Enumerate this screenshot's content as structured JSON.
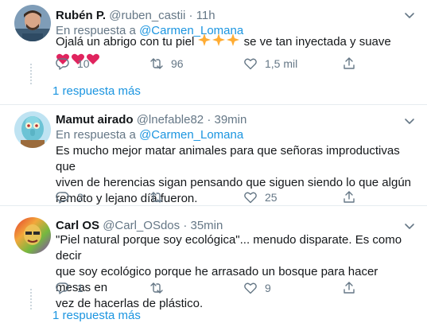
{
  "tweets": [
    {
      "name": "Rubén P.",
      "handle": "@ruben_castii",
      "dot": "·",
      "time": "11h",
      "reply_prefix": "En respuesta a",
      "reply_to": "@Carmen_Lomana",
      "text_before": "Ojalá un abrigo con tu piel",
      "text_after": "se ve tan inyectada y suave",
      "replies": "10",
      "retweets": "96",
      "likes": "1,5 mil",
      "more": "1 respuesta más"
    },
    {
      "name": "Mamut airado",
      "handle": "@lnefable82",
      "dot": "·",
      "time": "39min",
      "reply_prefix": "En respuesta a",
      "reply_to": "@Carmen_Lomana",
      "lines": [
        "Es mucho mejor matar animales para que señoras improductivas que",
        "viven de herencias sigan pensando que siguen siendo lo que algún",
        "remoto y lejano día fueron."
      ],
      "replies": "2",
      "retweets": "",
      "likes": "25"
    },
    {
      "name": "Carl OS",
      "handle": "@Carl_OSdos",
      "dot": "·",
      "time": "35min",
      "lines": [
        "\"Piel natural porque soy ecológica\"... menudo disparate. Es como decir",
        "que soy ecológico porque he arrasado un bosque para hacer mesas en",
        "vez de hacerlas de plástico."
      ],
      "replies": "1",
      "retweets": "",
      "likes": "9",
      "more": "1 respuesta más"
    }
  ],
  "colors": {
    "link": "#1b95e0",
    "meta": "#657786",
    "heart": "#e0245e",
    "sparkle": "#ffac33",
    "divider": "#e6ecf0"
  }
}
